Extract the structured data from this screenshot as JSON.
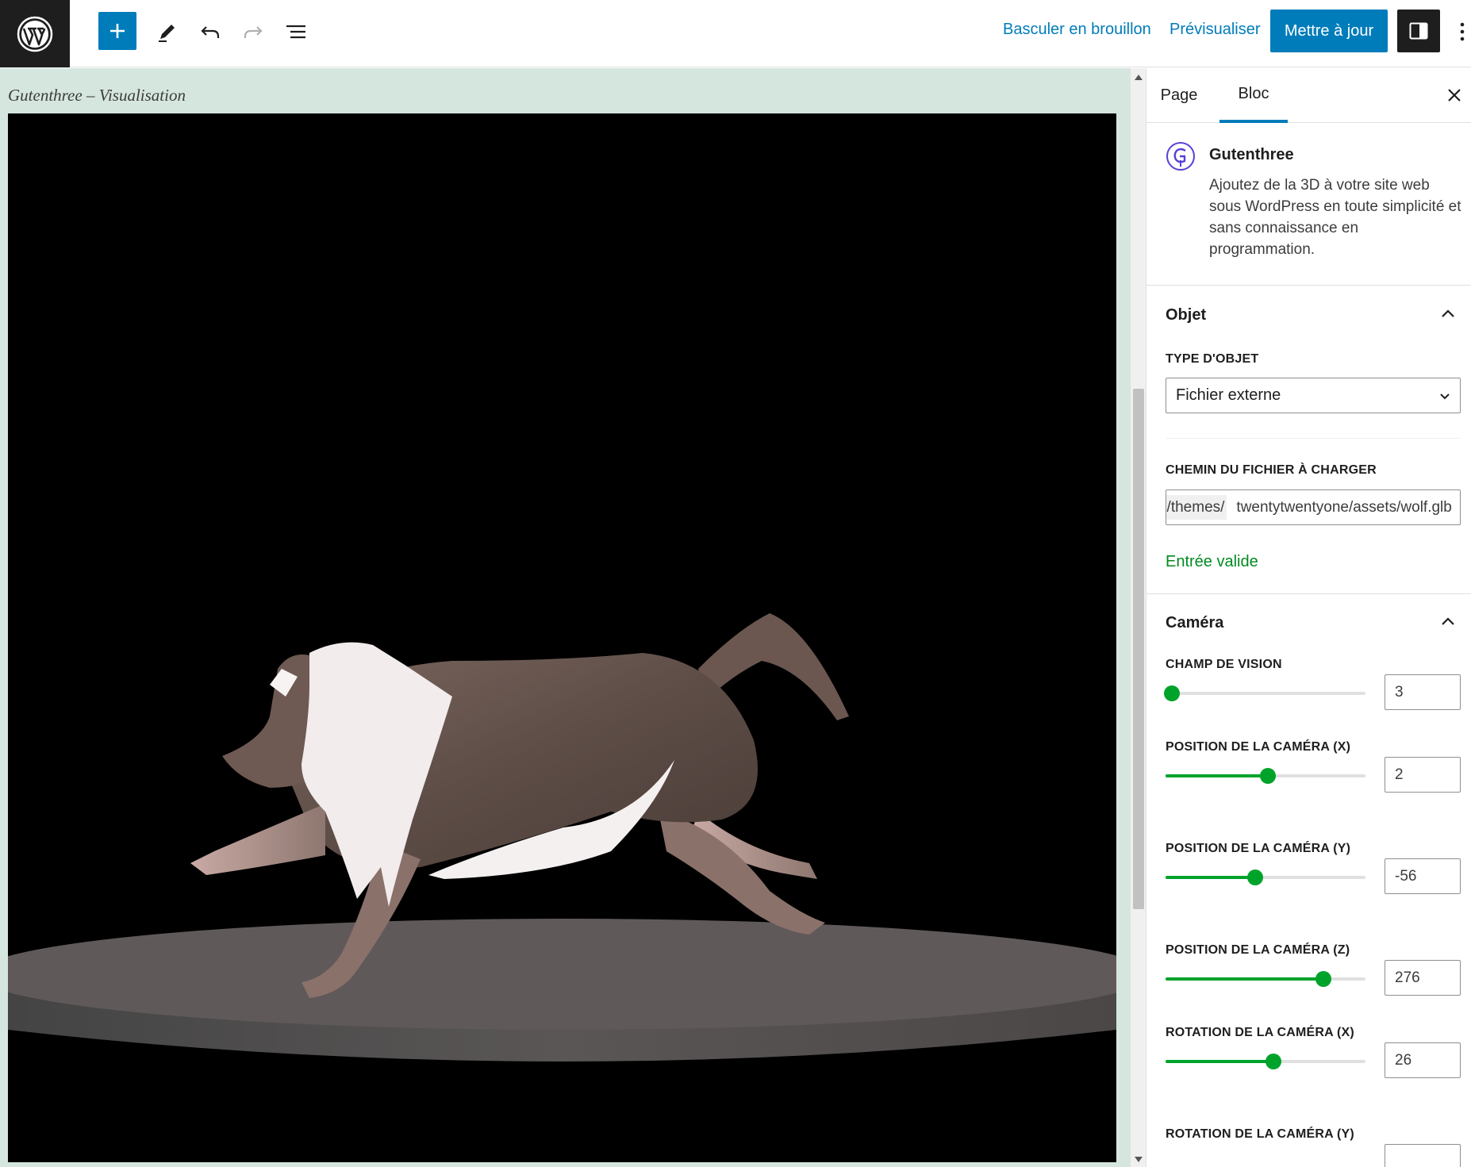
{
  "toolbar": {
    "switch_to_draft": "Basculer en brouillon",
    "preview": "Prévisualiser",
    "update": "Mettre à jour",
    "accent_color": "#007cba"
  },
  "canvas": {
    "block_label": "Gutenthree – Visualisation",
    "background": "#000000",
    "platform_color": "#5f5959"
  },
  "sidebar": {
    "tabs": [
      "Page",
      "Bloc"
    ],
    "active_tab": "Bloc",
    "block_card": {
      "title": "Gutenthree",
      "description": "Ajoutez de la 3D à votre site web sous WordPress en toute simplicité et sans connaissance en programmation."
    },
    "object_panel": {
      "title": "Objet",
      "object_type_label": "TYPE D'OBJET",
      "object_type_value": "Fichier externe",
      "file_path_label": "CHEMIN DU FICHIER À CHARGER",
      "file_path_prefix": "../themes/",
      "file_path_value": "twentytwentyone/assets/wolf.glb",
      "validation_message": "Entrée valide",
      "validation_color": "#008a20"
    },
    "camera_panel": {
      "title": "Caméra",
      "controls": [
        {
          "label": "CHAMP DE VISION",
          "value": "3",
          "fraction": 0.03
        },
        {
          "label": "POSITION DE LA CAMÉRA (X)",
          "value": "2",
          "fraction": 0.51
        },
        {
          "label": "POSITION DE LA CAMÉRA (Y)",
          "value": "-56",
          "fraction": 0.45
        },
        {
          "label": "POSITION DE LA CAMÉRA (Z)",
          "value": "276",
          "fraction": 0.79
        },
        {
          "label": "ROTATION DE LA CAMÉRA (X)",
          "value": "26",
          "fraction": 0.54
        },
        {
          "label": "ROTATION DE LA CAMÉRA (Y)",
          "value": "",
          "fraction": null
        }
      ]
    }
  }
}
